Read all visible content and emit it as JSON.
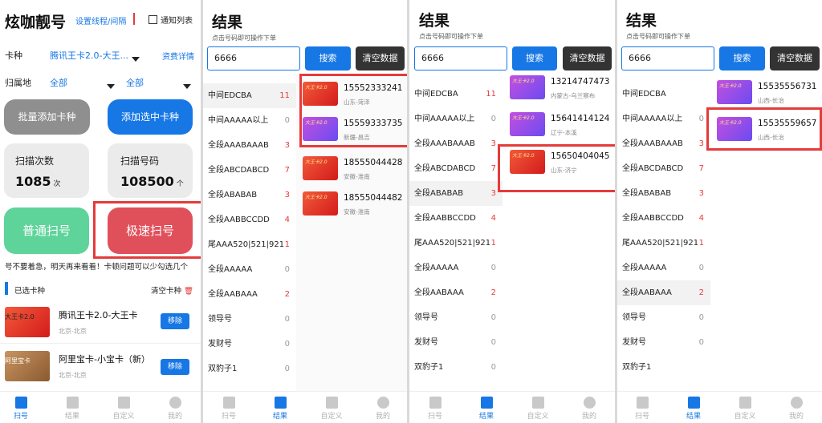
{
  "p1": {
    "title": "炫咖靓号",
    "thread_link": "设置线程/间隔",
    "notify_label": "通知列表",
    "card_type_label": "卡种",
    "card_type_value": "腾讯王卡2.0-大王...",
    "fee_link": "资费详情",
    "region_label": "归属地",
    "province_value": "全部",
    "city_value": "全部",
    "batch_add_label": "批量添加卡种",
    "add_selected_label": "添加选中卡种",
    "scan_count_label": "扫描次数",
    "scan_count_value": "1085",
    "scan_count_unit": "次",
    "scan_code_label": "扫描号码",
    "scan_code_value": "108500",
    "scan_code_unit": "个",
    "normal_scan_label": "普通扫号",
    "fast_scan_label": "极速扫号",
    "notice": "号不要着急，明天再来看看！卡顿问题可以少勾选几个",
    "selected_label": "已选卡种",
    "clear_label": "清空卡种",
    "selected": [
      {
        "name": "腾讯王卡2.0-大王卡",
        "area": "北京-北京",
        "remove": "移除",
        "thumb_text": "大王卡2.0"
      },
      {
        "name": "阿里宝卡-小宝卡（新）",
        "area": "北京-北京",
        "remove": "移除",
        "thumb_text": "阿里宝卡"
      }
    ]
  },
  "common": {
    "result_title": "结果",
    "subtitle": "点击号码即可操作下单",
    "search_value": "6666",
    "search_btn": "搜索",
    "clear_btn": "清空数据",
    "thumb_text": "大王卡2.0",
    "tabs": [
      "扫号",
      "结果",
      "自定义",
      "我的"
    ],
    "categories": [
      {
        "label": "中间EDCBA",
        "p2": "11",
        "p3": "11",
        "p4": ""
      },
      {
        "label": "中间AAAAA以上",
        "p2": "0",
        "p3": "0",
        "p4": "0"
      },
      {
        "label": "全段AAABAAAB",
        "p2": "3",
        "p3": "3",
        "p4": "3"
      },
      {
        "label": "全段ABCDABCD",
        "p2": "7",
        "p3": "7",
        "p4": "7"
      },
      {
        "label": "全段ABABAB",
        "p2": "3",
        "p3": "3",
        "p4": "3"
      },
      {
        "label": "全段AABBCCDD",
        "p2": "4",
        "p3": "4",
        "p4": "4"
      },
      {
        "label": "尾AAA520|521|921",
        "p2": "1",
        "p3": "1",
        "p4": "1"
      },
      {
        "label": "全段AAAAA",
        "p2": "0",
        "p3": "0",
        "p4": "0"
      },
      {
        "label": "全段AABAAA",
        "p2": "2",
        "p3": "2",
        "p4": "2"
      },
      {
        "label": "领导号",
        "p2": "0",
        "p3": "0",
        "p4": "0"
      },
      {
        "label": "发财号",
        "p2": "0",
        "p3": "0",
        "p4": "0"
      },
      {
        "label": "双豹子1",
        "p2": "0",
        "p3": "0",
        "p4": ""
      }
    ]
  },
  "p2_results": [
    {
      "phone": "15552333241",
      "loc": "山东-菏泽"
    },
    {
      "phone": "15559333735",
      "loc": "新疆-昌吉"
    },
    {
      "phone": "18555044428",
      "loc": "安徽-淮南"
    },
    {
      "phone": "18555044482",
      "loc": "安徽-淮南"
    }
  ],
  "p3_results": [
    {
      "phone": "13214747473",
      "loc": "内蒙古-乌兰察布"
    },
    {
      "phone": "15641414124",
      "loc": "辽宁-本溪"
    },
    {
      "phone": "15650404045",
      "loc": "山东-济宁"
    }
  ],
  "p4_results": [
    {
      "phone": "15535556731",
      "loc": "山西-长治"
    },
    {
      "phone": "15535559657",
      "loc": "山西-长治"
    }
  ]
}
